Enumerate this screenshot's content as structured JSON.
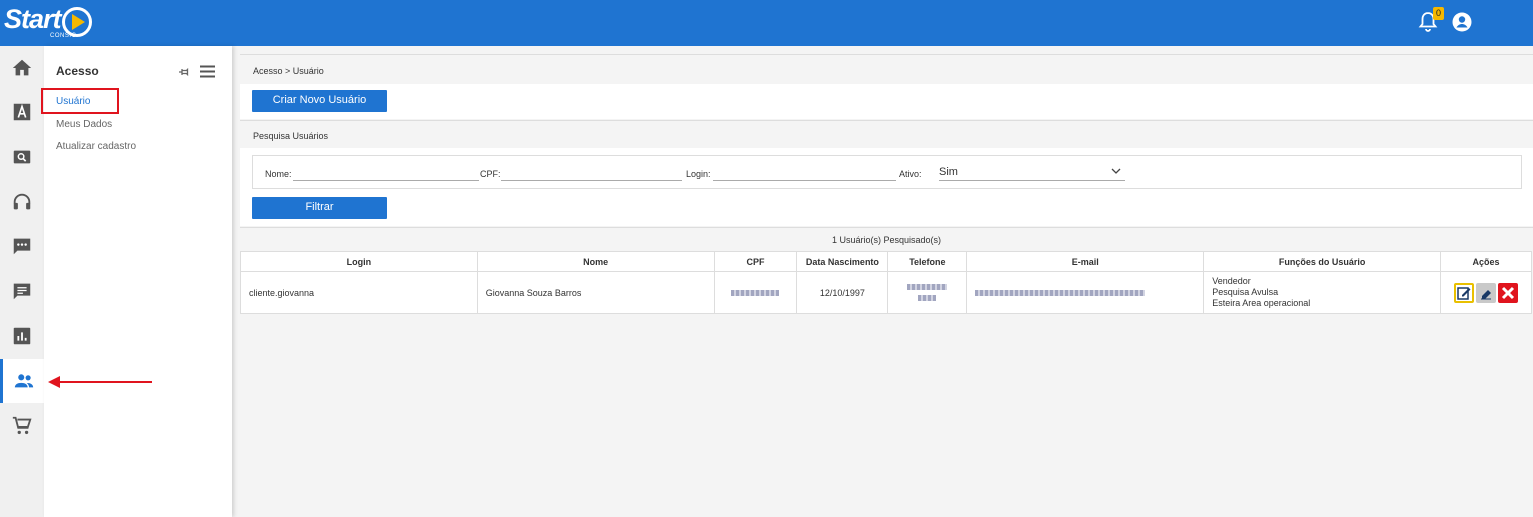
{
  "app": {
    "logo_text": "Start",
    "logo_sub": "CONSIG",
    "notification_count": "0"
  },
  "rail": {
    "items": [
      "home-icon",
      "letter-a-icon",
      "search-card-icon",
      "headset-icon",
      "chat-dots-icon",
      "message-icon",
      "bar-chart-icon",
      "users-icon",
      "cart-icon"
    ],
    "active": "users-icon"
  },
  "submenu": {
    "title": "Acesso",
    "items": [
      {
        "label": "Usuário",
        "selected": true
      },
      {
        "label": "Meus Dados",
        "selected": false
      },
      {
        "label": "Atualizar cadastro",
        "selected": false
      }
    ]
  },
  "main": {
    "breadcrumb": "Acesso > Usuário",
    "create_button": "Criar Novo Usuário",
    "search_title": "Pesquisa Usuários",
    "filters": {
      "nome_label": "Nome:",
      "cpf_label": "CPF:",
      "login_label": "Login:",
      "ativo_label": "Ativo:",
      "ativo_value": "Sim"
    },
    "filter_button": "Filtrar",
    "results_count": "1 Usuário(s) Pesquisado(s)",
    "table": {
      "headers": [
        "Login",
        "Nome",
        "CPF",
        "Data Nascimento",
        "Telefone",
        "E-mail",
        "Funções do Usuário",
        "Ações"
      ],
      "rows": [
        {
          "login": "cliente.giovanna",
          "nome": "Giovanna Souza Barros",
          "data_nascimento": "12/10/1997",
          "funcoes": [
            "Vendedor",
            "Pesquisa Avulsa",
            "Esteira Area operacional"
          ]
        }
      ]
    }
  },
  "colors": {
    "primary": "#1f74d1",
    "accent": "#f6b800",
    "danger": "#e0141e"
  }
}
